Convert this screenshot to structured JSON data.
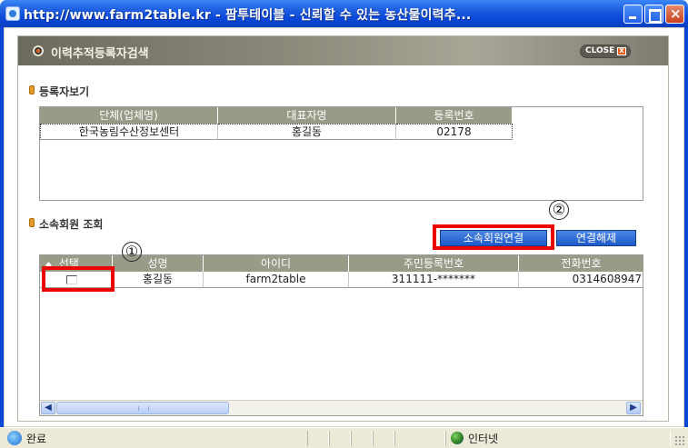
{
  "window": {
    "title": "http://www.farm2table.kr - 팜투테이블 - 신뢰할 수 있는 농산물이력추..."
  },
  "popup": {
    "title": "이력추적등록자검색",
    "close_label": "CLOSE",
    "close_x": "X"
  },
  "registrant_section": {
    "title": "등록자보기",
    "columns": [
      "단체(업체명)",
      "대표자명",
      "등록번호"
    ],
    "rows": [
      [
        "한국농림수산정보센터",
        "홍길동",
        "02178"
      ]
    ]
  },
  "member_section": {
    "title": "소속회원 조회",
    "link_button": "소속회원연결",
    "unlink_button": "연결해제",
    "sort_icon": "◆",
    "columns": [
      "선택",
      "성명",
      "아이디",
      "주민등록번호",
      "전화번호"
    ],
    "rows": [
      {
        "checked": false,
        "name": "홍길동",
        "id": "farm2table",
        "rrn": "311111-*******",
        "phone": "0314608947"
      }
    ]
  },
  "annotations": {
    "marker_1": "①",
    "marker_2": "②",
    "highlight_color": "#ee0000"
  },
  "statusbar": {
    "status": "완료",
    "zone": "인터넷"
  },
  "colors": {
    "titlebar": "#0a46d8",
    "grid_header": "#9a9a88",
    "button": "#1d5ac9"
  }
}
